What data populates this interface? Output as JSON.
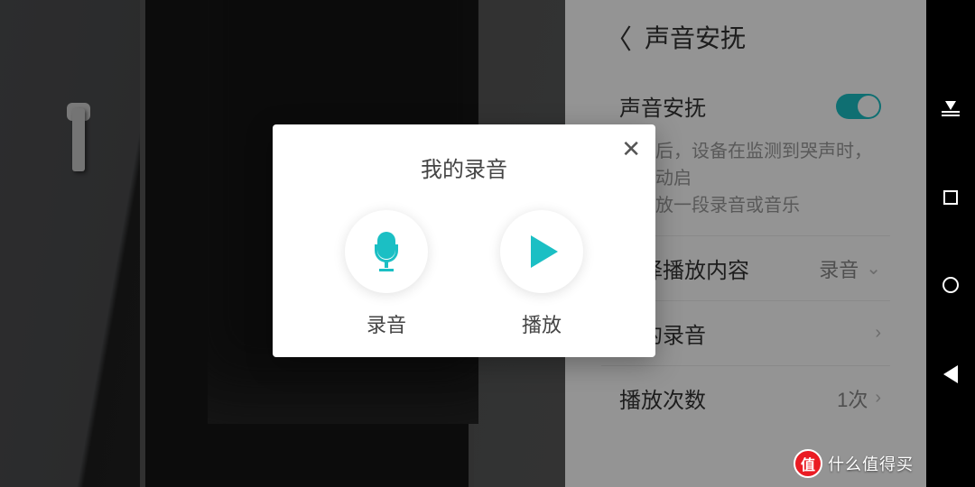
{
  "header": {
    "title": "声音安抚"
  },
  "settings": {
    "toggle_label": "声音安抚",
    "toggle_on": true,
    "description_l1": "开启后，设备在监测到哭声时，会自动启",
    "description_l2": "动播放一段录音或音乐",
    "rows": [
      {
        "label": "选择播放内容",
        "value": "录音",
        "chevron": true
      },
      {
        "label": "我的录音",
        "value": "",
        "chevron": true
      },
      {
        "label": "播放次数",
        "value": "1次",
        "chevron": true
      }
    ]
  },
  "modal": {
    "title": "我的录音",
    "record_label": "录音",
    "play_label": "播放"
  },
  "watermark": {
    "badge": "值",
    "text": "什么值得买"
  },
  "colors": {
    "accent": "#1bbfc4"
  }
}
